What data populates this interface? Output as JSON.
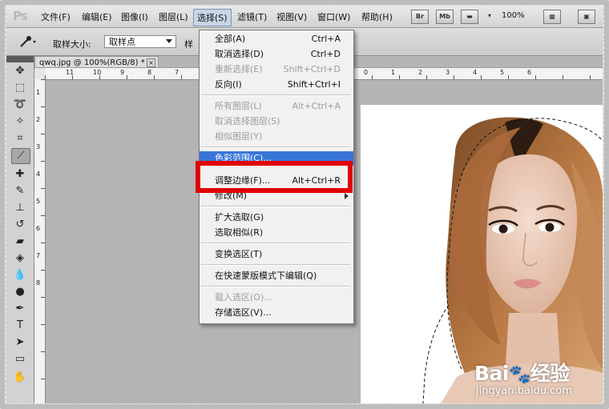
{
  "app": {
    "logo": "Ps"
  },
  "menubar": {
    "items": [
      "文件(F)",
      "编辑(E)",
      "图像(I)",
      "图层(L)",
      "选择(S)",
      "滤镜(T)",
      "视图(V)",
      "窗口(W)",
      "帮助(H)"
    ],
    "active_index": 4,
    "buttons": [
      "Br",
      "Mb"
    ],
    "zoom": "100%"
  },
  "options": {
    "sample_size_label": "取样大小:",
    "sample_size_value": "取样点",
    "tolerance_label": "样"
  },
  "document": {
    "tab_title": "qwq.jpg @ 100%(RGB/8) *",
    "close": "×"
  },
  "rulers": {
    "top": [
      "11",
      "10",
      "9",
      "8",
      "7",
      "0",
      "1",
      "2",
      "3",
      "4",
      "5",
      "6"
    ],
    "left": [
      "1",
      "2",
      "3",
      "4",
      "5",
      "6",
      "7",
      "8"
    ]
  },
  "select_menu": {
    "items": [
      {
        "label": "全部(A)",
        "shortcut": "Ctrl+A",
        "enabled": true
      },
      {
        "label": "取消选择(D)",
        "shortcut": "Ctrl+D",
        "enabled": true
      },
      {
        "label": "重新选择(E)",
        "shortcut": "Shift+Ctrl+D",
        "enabled": false
      },
      {
        "label": "反向(I)",
        "shortcut": "Shift+Ctrl+I",
        "enabled": true
      },
      {
        "label": "所有图层(L)",
        "shortcut": "Alt+Ctrl+A",
        "enabled": false
      },
      {
        "label": "取消选择图层(S)",
        "shortcut": "",
        "enabled": false
      },
      {
        "label": "相似图层(Y)",
        "shortcut": "",
        "enabled": false
      },
      {
        "label": "色彩范围(C)...",
        "shortcut": "",
        "enabled": true
      },
      {
        "label": "调整边缘(F)...",
        "shortcut": "Alt+Ctrl+R",
        "enabled": true
      },
      {
        "label": "修改(M)",
        "shortcut": "",
        "enabled": true
      },
      {
        "label": "扩大选取(G)",
        "shortcut": "",
        "enabled": true
      },
      {
        "label": "选取相似(R)",
        "shortcut": "",
        "enabled": true
      },
      {
        "label": "变换选区(T)",
        "shortcut": "",
        "enabled": true
      },
      {
        "label": "在快速蒙版模式下编辑(Q)",
        "shortcut": "",
        "enabled": true
      },
      {
        "label": "载入选区(O)...",
        "shortcut": "",
        "enabled": false
      },
      {
        "label": "存储选区(V)...",
        "shortcut": "",
        "enabled": true
      }
    ],
    "highlight_color": "#3875d7",
    "callout_color": "#e00000"
  },
  "watermark": {
    "brand": "Bai",
    "brand_cn": "经验",
    "url": "jingyan.baidu.com"
  }
}
